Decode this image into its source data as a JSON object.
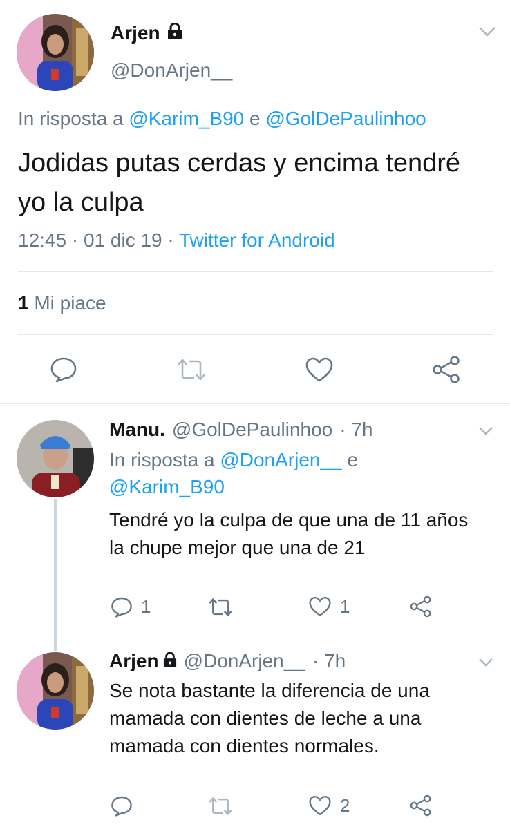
{
  "main": {
    "name": "Arjen",
    "handle": "@DonArjen__",
    "reply_prefix": "In risposta a",
    "reply_user1": "@Karim_B90",
    "reply_conj": "e",
    "reply_user2": "@GolDePaulinhoo",
    "text": "Jodidas putas cerdas y encima tendré yo la culpa",
    "time": "12:45",
    "sep": "·",
    "date": "01 dic 19",
    "source": "Twitter for Android",
    "likes_count": "1",
    "likes_label": "Mi piace"
  },
  "replies": [
    {
      "name": "Manu.",
      "handle": "@GolDePaulinhoo",
      "age": "· 7h",
      "reply_prefix": "In risposta a",
      "reply_user1": "@DonArjen__",
      "reply_conj": "e",
      "reply_user2": "@Karim_B90",
      "text": "Tendré yo la culpa de que una de 11 años la chupe mejor que una de 21",
      "reply_count": "1",
      "like_count": "1"
    },
    {
      "name": "Arjen",
      "handle": "@DonArjen__",
      "age": "· 7h",
      "text": "Se nota bastante la diferencia de una mamada con dientes de leche a una mamada con dientes normales.",
      "like_count": "2"
    }
  ],
  "icons": [
    "lock-icon",
    "chevron-down-icon",
    "reply-icon",
    "retweet-icon",
    "like-icon",
    "share-icon"
  ],
  "colors": {
    "link": "#1da1f2",
    "secondary_text": "#657786",
    "primary_text": "#14171a",
    "divider": "#e1e8ed"
  }
}
